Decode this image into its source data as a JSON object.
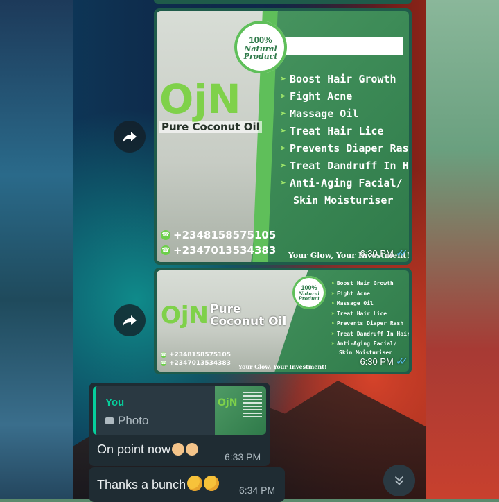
{
  "messages": {
    "poster_large": {
      "badge_top": "100%",
      "badge_bottom": "Natural Product",
      "brand": "OjN",
      "product": "Pure Coconut Oil",
      "features": [
        "Boost Hair Growth",
        "Fight Acne",
        "Massage Oil",
        "Treat Hair Lice",
        "Prevents Diaper Rash",
        "Treat Dandruff In Hair",
        "Anti-Aging Facial/",
        "Skin Moisturiser"
      ],
      "phones": [
        "+2348158575105",
        "+2347013534383"
      ],
      "tagline": "Your Glow, Your Investment!",
      "time": "6:30 PM"
    },
    "poster_small": {
      "badge_top": "100%",
      "badge_bottom": "Natural Product",
      "brand": "OjN",
      "product_line1": "Pure",
      "product_line2": "Coconut Oil",
      "features": [
        "Boost Hair Growth",
        "Fight Acne",
        "Massage Oil",
        "Treat Hair Lice",
        "Prevents Diaper Rash",
        "Treat Dandruff In Hair",
        "Anti-Aging Facial/",
        "Skin Moisturiser"
      ],
      "phones": [
        "+2348158575105",
        "+2347013534383"
      ],
      "tagline": "Your Glow, Your Investment!",
      "time": "6:30 PM"
    },
    "reply": {
      "quote_author": "You",
      "quote_type": "Photo",
      "thumb_brand": "OjN",
      "text": "On point now",
      "emoji_names": [
        "ok-hand-emoji",
        "ok-hand-emoji"
      ],
      "time": "6:33 PM"
    },
    "thanks": {
      "text": "Thanks a bunch",
      "emoji_names": [
        "kiss-face-emoji",
        "kiss-face-emoji"
      ],
      "time": "6:34 PM"
    }
  },
  "icons": {
    "forward": "forward-icon",
    "scroll_down": "double-chevron-down-icon",
    "read_receipt": "double-check-icon",
    "camera": "camera-icon"
  },
  "colors": {
    "bubble_outgoing": "#1f2c33",
    "quote_accent": "#06cf9c",
    "read_tick": "#53bdeb",
    "poster_green": "#3d8b57",
    "brand_green": "#7fd14a"
  }
}
